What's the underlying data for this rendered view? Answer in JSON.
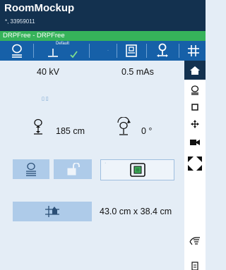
{
  "app": {
    "title": "RoomMockup",
    "subtitle": "*, 33959011"
  },
  "status": {
    "label": "DRPFree - DRPFree"
  },
  "toolbar": {
    "default_label": "Default",
    "dot_label": "·",
    "icons": [
      "detector-icon",
      "table-detector-icon",
      "default-check-icon",
      "wall-stand-icon",
      "patient-position-icon",
      "grid-icon"
    ]
  },
  "exposure": {
    "kv": "40 kV",
    "mas": "0.5 mAs"
  },
  "geometry": {
    "distance": "185 cm",
    "angle": "0 °",
    "ghost_marks": "▯ ▯"
  },
  "field_size": {
    "value": "43.0 cm x 38.4 cm"
  },
  "sidebar": {
    "icons": [
      "home-icon",
      "detector-icon",
      "collimator-icon",
      "move-icon",
      "camera-icon",
      "expand-icon",
      "hand-icon",
      "document-icon"
    ]
  },
  "colors": {
    "titlebar": "#13314f",
    "status": "#36b35a",
    "toolbar": "#1660a8",
    "background": "#e4edf6",
    "button": "#aecbe9"
  }
}
